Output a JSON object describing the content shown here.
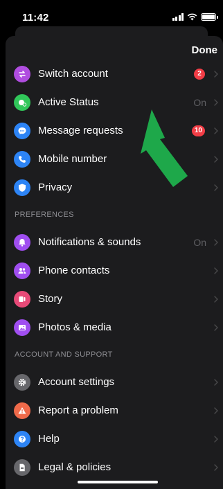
{
  "status_bar": {
    "time": "11:42"
  },
  "header": {
    "done_label": "Done"
  },
  "colors": {
    "arrow": "#1ea84a",
    "badge": "#f23d46"
  },
  "account_items": [
    {
      "label": "Switch account",
      "icon": "switch-account-icon",
      "color": "#b04de0",
      "badge": "2",
      "value": ""
    },
    {
      "label": "Active Status",
      "icon": "active-status-icon",
      "color": "#31c75a",
      "badge": "",
      "value": "On"
    },
    {
      "label": "Message requests",
      "icon": "message-requests-icon",
      "color": "#2d84f5",
      "badge": "10",
      "value": ""
    },
    {
      "label": "Mobile number",
      "icon": "phone-icon",
      "color": "#2d84f5",
      "badge": "",
      "value": ""
    },
    {
      "label": "Privacy",
      "icon": "shield-icon",
      "color": "#2d84f5",
      "badge": "",
      "value": ""
    }
  ],
  "preferences": {
    "header": "PREFERENCES",
    "items": [
      {
        "label": "Notifications & sounds",
        "icon": "bell-icon",
        "color": "#a04ef0",
        "value": "On"
      },
      {
        "label": "Phone contacts",
        "icon": "contacts-icon",
        "color": "#a04ef0",
        "value": ""
      },
      {
        "label": "Story",
        "icon": "story-icon",
        "color": "#e84a78",
        "value": ""
      },
      {
        "label": "Photos & media",
        "icon": "photos-icon",
        "color": "#a04ef0",
        "value": ""
      }
    ]
  },
  "support": {
    "header": "ACCOUNT AND SUPPORT",
    "items": [
      {
        "label": "Account settings",
        "icon": "gear-icon",
        "color": "#67676b",
        "value": ""
      },
      {
        "label": "Report a problem",
        "icon": "warning-icon",
        "color": "#ef6a4a",
        "value": ""
      },
      {
        "label": "Help",
        "icon": "help-icon",
        "color": "#2d84f5",
        "value": ""
      },
      {
        "label": "Legal & policies",
        "icon": "document-icon",
        "color": "#67676b",
        "value": ""
      }
    ]
  }
}
